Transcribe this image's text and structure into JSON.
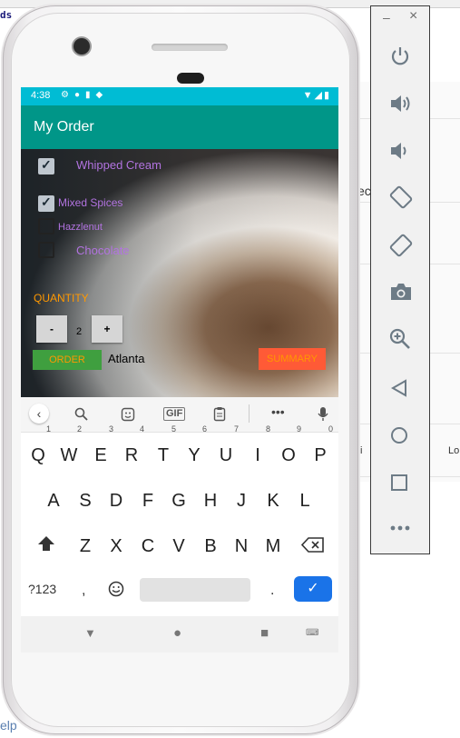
{
  "background": {
    "code_fragment": "ds",
    "right_fragment_1": "ec",
    "right_fragment_2": "ti",
    "right_fragment_3": "Lo",
    "help_fragment": "elp"
  },
  "device": {
    "status_bar": {
      "time": "4:38"
    },
    "app_bar": {
      "title": "My Order"
    },
    "toppings": [
      {
        "label": "Whipped Cream",
        "checked": true
      },
      {
        "label": "Mixed Spices",
        "checked": true
      },
      {
        "label": "Hazzlenut",
        "checked": false
      },
      {
        "label": "Chocolate",
        "checked": false
      }
    ],
    "quantity": {
      "label": "QUANTITY",
      "decrement_label": "-",
      "value": "2",
      "increment_label": "+"
    },
    "order_button": "ORDER",
    "city_text": "Atlanta",
    "summary_button": "SUMMARY",
    "keyboard": {
      "suggestion_icons": [
        "back-icon",
        "search-icon",
        "sticker-icon",
        "gif-icon",
        "clipboard-icon",
        "more-icon",
        "mic-icon"
      ],
      "gif_label": "GIF",
      "row1": [
        "Q",
        "W",
        "E",
        "R",
        "T",
        "Y",
        "U",
        "I",
        "O",
        "P"
      ],
      "row1_hints": [
        "1",
        "2",
        "3",
        "4",
        "5",
        "6",
        "7",
        "8",
        "9",
        "0"
      ],
      "row2": [
        "A",
        "S",
        "D",
        "F",
        "G",
        "H",
        "J",
        "K",
        "L"
      ],
      "row3": [
        "Z",
        "X",
        "C",
        "V",
        "B",
        "N",
        "M"
      ],
      "symbols_label": "?123",
      "comma": ",",
      "period": "."
    }
  },
  "emulator_toolbar": {
    "minimize": "–",
    "close": "×",
    "icons": [
      "power-icon",
      "volume-up-icon",
      "volume-down-icon",
      "rotate-left-icon",
      "rotate-right-icon",
      "camera-icon",
      "zoom-icon",
      "back-icon",
      "home-icon",
      "overview-icon",
      "more-icon"
    ]
  },
  "colors": {
    "status_bar": "#00bcd4",
    "app_bar": "#009688",
    "topping_text": "#b273e0",
    "quantity_label": "#ff9800",
    "order_button_bg": "#3f9f3f",
    "summary_button_bg": "#ff5a36",
    "enter_key": "#1a73e8"
  }
}
